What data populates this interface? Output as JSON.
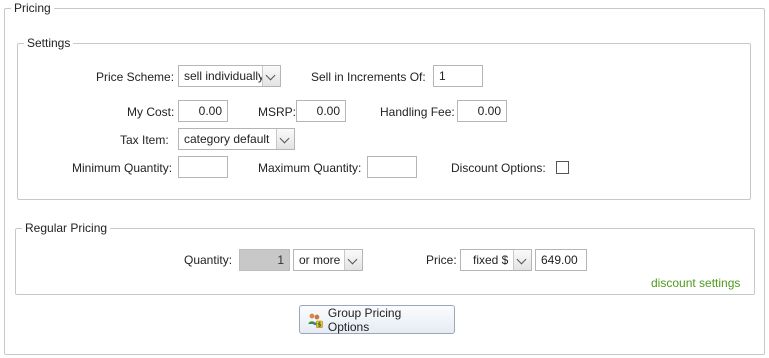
{
  "pricing": {
    "legend": "Pricing",
    "settings": {
      "legend": "Settings",
      "price_scheme_label": "Price Scheme:",
      "price_scheme_value": "sell individually",
      "sell_increments_label": "Sell in Increments Of:",
      "sell_increments_value": "1",
      "my_cost_label": "My Cost:",
      "my_cost_value": "0.00",
      "msrp_label": "MSRP:",
      "msrp_value": "0.00",
      "handling_fee_label": "Handling Fee:",
      "handling_fee_value": "0.00",
      "tax_item_label": "Tax Item:",
      "tax_item_value": "category default",
      "min_qty_label": "Minimum Quantity:",
      "min_qty_value": "",
      "max_qty_label": "Maximum Quantity:",
      "max_qty_value": "",
      "discount_options_label": "Discount Options:",
      "discount_options_checked": false
    },
    "regular_pricing": {
      "legend": "Regular Pricing",
      "quantity_label": "Quantity:",
      "quantity_value": "1",
      "quantity_mode": "or more",
      "price_label": "Price:",
      "price_type": "fixed $",
      "price_value": "649.00",
      "discount_settings_link": "discount settings"
    },
    "group_pricing_button": "Group Pricing Options"
  },
  "colors": {
    "border": "#c8c8c8",
    "link": "#4e9a1c",
    "disabled_field": "#c8c8c8"
  },
  "icons": {
    "group_pricing": "group-pricing-icon"
  }
}
